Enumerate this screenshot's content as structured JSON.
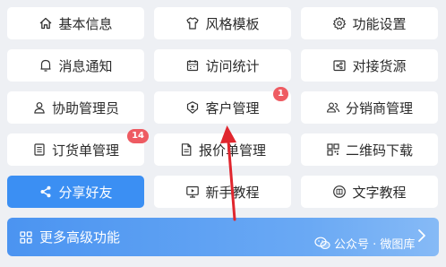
{
  "tiles": [
    {
      "label": "基本信息",
      "icon": "home-icon"
    },
    {
      "label": "风格模板",
      "icon": "shirt-icon"
    },
    {
      "label": "功能设置",
      "icon": "gear-icon"
    },
    {
      "label": "消息通知",
      "icon": "bell-icon"
    },
    {
      "label": "访问统计",
      "icon": "calendar-icon"
    },
    {
      "label": "对接货源",
      "icon": "share-box-icon"
    },
    {
      "label": "协助管理员",
      "icon": "user-icon"
    },
    {
      "label": "客户管理",
      "icon": "customer-shield-icon",
      "badge": "1"
    },
    {
      "label": "分销商管理",
      "icon": "users-icon"
    },
    {
      "label": "订货单管理",
      "icon": "list-icon",
      "badge": "14"
    },
    {
      "label": "报价单管理",
      "icon": "document-icon"
    },
    {
      "label": "二维码下载",
      "icon": "qrcode-icon"
    },
    {
      "label": "分享好友",
      "icon": "share-icon"
    },
    {
      "label": "新手教程",
      "icon": "monitor-icon"
    },
    {
      "label": "文字教程",
      "icon": "text-tutorial-icon"
    }
  ],
  "more": {
    "label": "更多高级功能",
    "icon": "grid-icon"
  },
  "watermark": {
    "text": "公众号 · 微图库"
  },
  "colors": {
    "accent": "#3b8ff3",
    "badge": "#ee5b62",
    "arrow": "#e0262e"
  }
}
